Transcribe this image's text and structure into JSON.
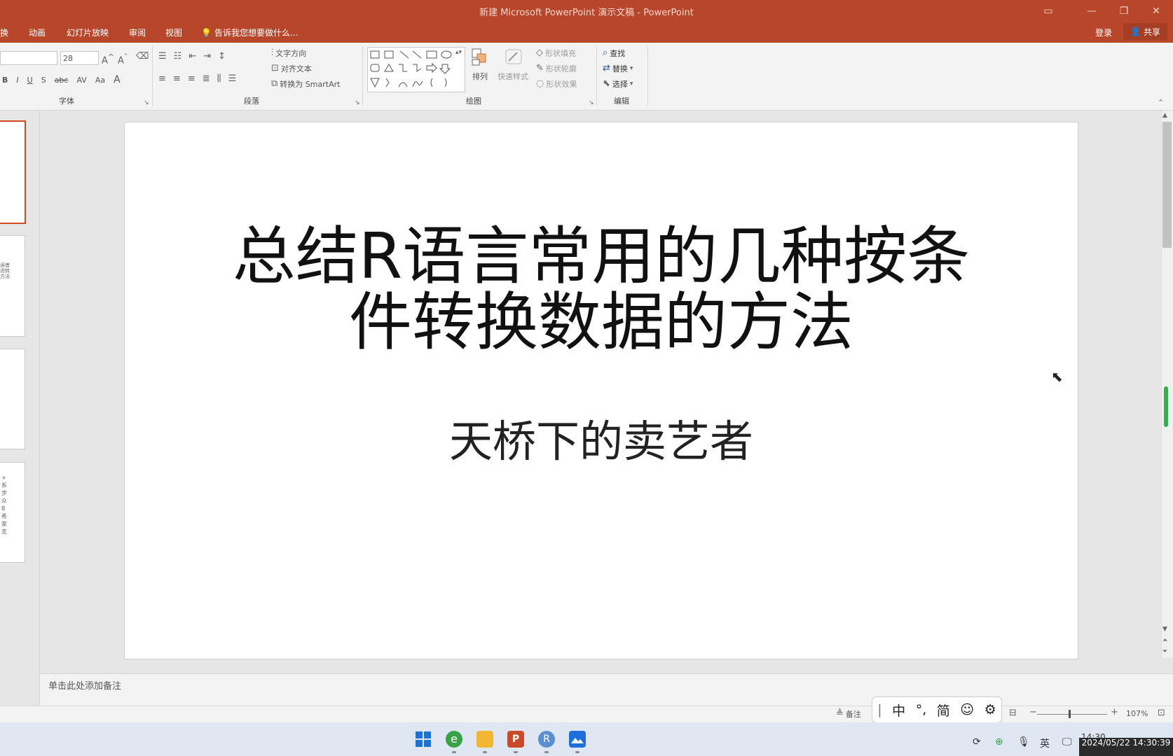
{
  "window": {
    "title": "新建 Microsoft PowerPoint 演示文稿 - PowerPoint",
    "controls": [
      "▭",
      "—",
      "❐",
      "✕"
    ]
  },
  "tabs": [
    "换",
    "动画",
    "幻灯片放映",
    "审阅",
    "视图"
  ],
  "tell_me": "告诉我您想要做什么...",
  "account": {
    "login": "登录",
    "share": "共享"
  },
  "ribbon": {
    "font": {
      "size": "28",
      "group_label": "字体",
      "bold": "B",
      "italic": "I",
      "underline": "U",
      "shadow": "S",
      "strike": "abc",
      "spacing": "AV",
      "case": "Aa",
      "color": "A"
    },
    "paragraph": {
      "group_label": "段落",
      "text_direction": "文字方向",
      "align_text": "对齐文本",
      "smartart": "转换为 SmartArt"
    },
    "drawing": {
      "group_label": "绘图",
      "arrange": "排列",
      "quick_styles": "快速样式",
      "fill": "形状填充",
      "outline": "形状轮廓",
      "effects": "形状效果"
    },
    "editing": {
      "group_label": "编辑",
      "find": "查找",
      "replace": "替换",
      "select": "选择"
    }
  },
  "slide": {
    "title_line1": "总结R语言常用的几种按条",
    "title_line2": "件转换数据的方法",
    "subtitle": "天桥下的卖艺者"
  },
  "thumbnails": {
    "slide2_text": "读者\n进转\n方法",
    "slide4_text": "+\n系\n步\n众\nB\n希\n家\n支"
  },
  "notes_placeholder": "单击此处添加备注",
  "status": {
    "notes_button": "备注",
    "zoom": "107%",
    "zoom_level": 0.45
  },
  "ime": {
    "cursor": "|",
    "mode": "中",
    "punct": "°,",
    "charset": "简",
    "emoji": "☺",
    "settings": "⚙"
  },
  "tray": {
    "lang": "英",
    "time": "14:30",
    "timestamp": "2024/05/22 14:30:39"
  },
  "colors": {
    "accent": "#b7472a",
    "selected_thumb": "#d24726"
  }
}
